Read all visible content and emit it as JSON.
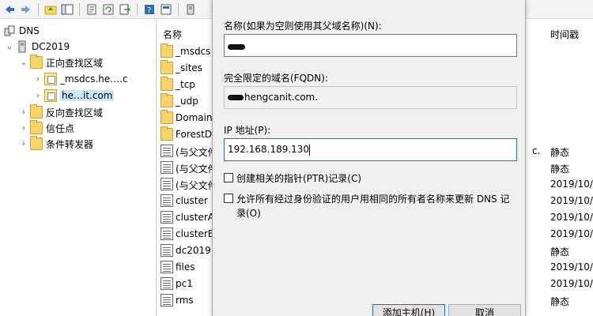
{
  "tree": {
    "root": "DNS",
    "server": "DC2019",
    "forward_zones": "正向查找区域",
    "zone_msdcs": "_msdcs.he….c",
    "zone_main": "he…it.com",
    "reverse_zones": "反向查找区域",
    "trust_points": "信任点",
    "conditional_forwarders": "条件转发器"
  },
  "list": {
    "col_name": "名称",
    "col_time": "时间戳",
    "rows": [
      {
        "name": "_msdcs",
        "type": "",
        "time": ""
      },
      {
        "name": "_sites",
        "type": "",
        "time": ""
      },
      {
        "name": "_tcp",
        "type": "",
        "time": ""
      },
      {
        "name": "_udp",
        "type": "",
        "time": ""
      },
      {
        "name": "Domain",
        "type": "",
        "time": ""
      },
      {
        "name": "ForestD",
        "type": "",
        "time": ""
      },
      {
        "name": "(与父文件",
        "type": "c.",
        "time": "静态"
      },
      {
        "name": "(与父文件",
        "type": "",
        "time": "静态"
      },
      {
        "name": "(与父文件",
        "type": "",
        "time": "2019/10/"
      },
      {
        "name": "cluster",
        "type": "",
        "time": "2019/10/"
      },
      {
        "name": "clusterA",
        "type": "",
        "time": "2019/10/"
      },
      {
        "name": "clusterB",
        "type": "",
        "time": "2019/10/"
      },
      {
        "name": "dc2019",
        "type": "",
        "time": "静态"
      },
      {
        "name": "files",
        "type": "",
        "time": "2019/10/"
      },
      {
        "name": "pc1",
        "type": "",
        "time": "2019/10/"
      },
      {
        "name": "rms",
        "type": "",
        "time": "静态"
      }
    ]
  },
  "dialog": {
    "name_label": "名称(如果为空则使用其父域名称)(N):",
    "fqdn_label": "完全限定的域名(FQDN):",
    "fqdn_value": "hengcanit.com.",
    "ip_label": "IP 地址(P):",
    "ip_value": "192.168.189.130",
    "ptr_label": "创建相关的指针(PTR)记录(C)",
    "allow_label": "允许所有经过身份验证的用户用相同的所有者名称来更新 DNS 记录(O)",
    "add_host_button": "添加主机(H)",
    "cancel_button": "取消"
  }
}
